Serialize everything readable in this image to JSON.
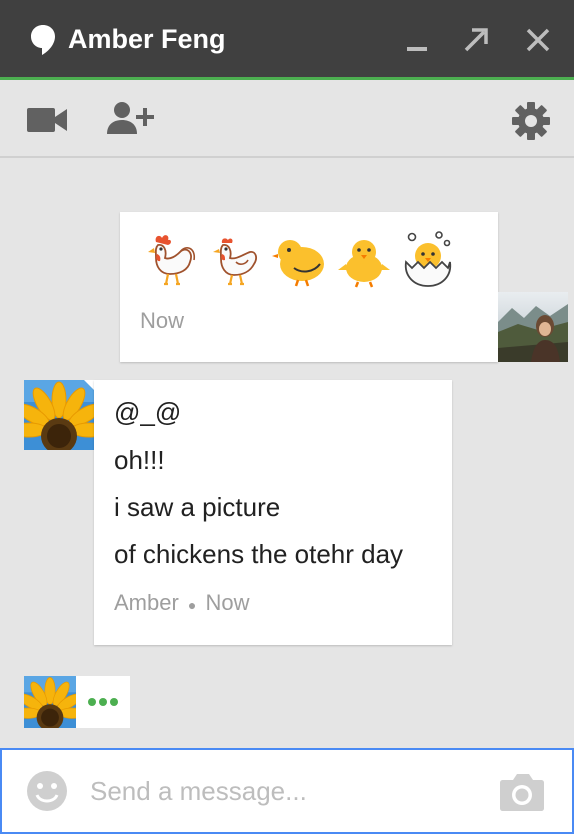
{
  "window": {
    "title": "Amber Feng",
    "accent_color": "#4caf50",
    "icons": [
      "hangouts-bubble-icon",
      "minimize-icon",
      "popout-icon",
      "close-icon"
    ]
  },
  "toolbar": {
    "icons": [
      "video-call-icon",
      "add-person-icon",
      "settings-gear-icon"
    ]
  },
  "messages": [
    {
      "sender": "self",
      "emoji": [
        "rooster",
        "hen",
        "front-facing baby chick",
        "baby chick",
        "hatching chick"
      ],
      "time": "Now"
    },
    {
      "sender": "Amber",
      "lines": [
        "@_@",
        "oh!!!",
        "i saw a picture",
        "of chickens the otehr day"
      ],
      "time": "Now"
    }
  ],
  "typing_indicator": {
    "dots": 3,
    "color": "#4caf50"
  },
  "composer": {
    "placeholder": "Send a message...",
    "value": "",
    "focus_color": "#4a8af4",
    "icons": [
      "emoji-smiley-icon",
      "camera-icon"
    ]
  }
}
